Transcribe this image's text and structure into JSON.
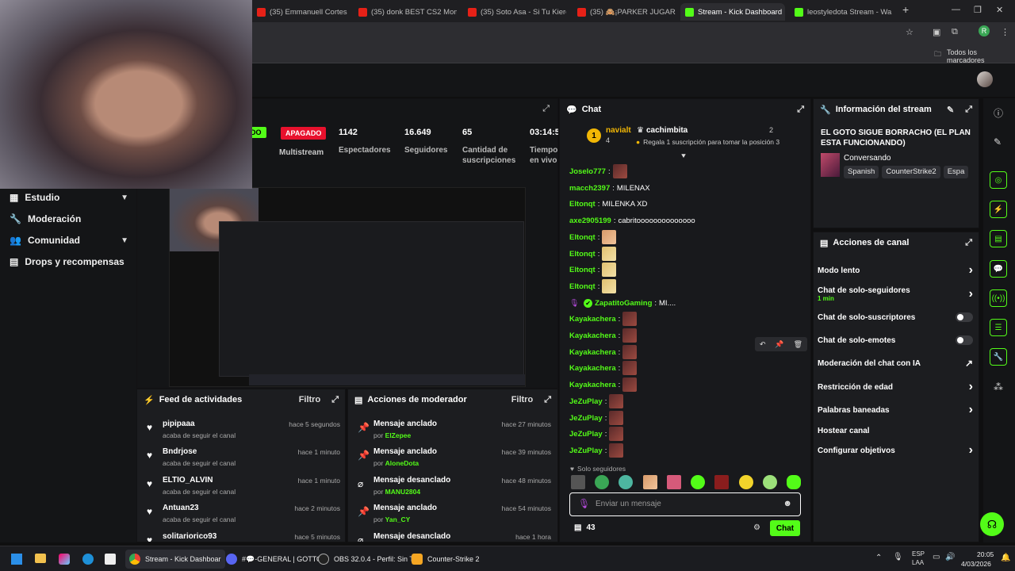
{
  "browser": {
    "tabs": [
      {
        "label": "(35) Emmanuell Cortess -",
        "icon": "youtube-icon"
      },
      {
        "label": "(35) donk BEST CS2 Mom",
        "icon": "youtube-icon"
      },
      {
        "label": "(35) Soto Asa - Si Tu Kiere",
        "icon": "youtube-icon"
      },
      {
        "label": "(35) 🙈¡PARKER JUGARA",
        "icon": "youtube-icon"
      },
      {
        "label": "Stream - Kick Dashboard",
        "icon": "kick-icon"
      },
      {
        "label": "leostyledota Stream - Wa",
        "icon": "kick-icon"
      }
    ],
    "bookmarks_label": "Todos los marcadores",
    "profile_initial": "R"
  },
  "sidebar": {
    "items": [
      {
        "label": "Estudio",
        "icon": "studio-icon",
        "chevron": true
      },
      {
        "label": "Moderación",
        "icon": "wrench-icon",
        "chevron": false
      },
      {
        "label": "Comunidad",
        "icon": "community-icon",
        "chevron": true
      },
      {
        "label": "Drops y recompensas",
        "icon": "gift-icon",
        "chevron": false
      }
    ]
  },
  "stats": {
    "status_partial": "DO",
    "apagado": "APAGADO",
    "multistream": "Multistream",
    "items": [
      {
        "value": "1142",
        "label": "Espectadores"
      },
      {
        "value": "16.649",
        "label": "Seguidores"
      },
      {
        "value": "65",
        "label": "Cantidad de suscripciones"
      },
      {
        "value": "03:14:5",
        "label": "Tiempo en vivo"
      }
    ]
  },
  "feed": {
    "title": "Feed de actividades",
    "filter": "Filtro",
    "rows": [
      {
        "name": "pipipaaa",
        "sub": "acaba de seguir el canal",
        "time": "hace 5 segundos"
      },
      {
        "name": "Bndrjose",
        "sub": "acaba de seguir el canal",
        "time": "hace 1 minuto"
      },
      {
        "name": "ELTIO_ALVIN",
        "sub": "acaba de seguir el canal",
        "time": "hace 1 minuto"
      },
      {
        "name": "Antuan23",
        "sub": "acaba de seguir el canal",
        "time": "hace 2 minutos"
      },
      {
        "name": "solitariorico93",
        "sub": "",
        "time": "hace 5 minutos"
      }
    ]
  },
  "mod": {
    "title": "Acciones de moderador",
    "filter": "Filtro",
    "rows": [
      {
        "action": "Mensaje anclado",
        "by": "por ",
        "user": "ElZepee",
        "time": "hace 27 minutos",
        "icon": "pin-icon"
      },
      {
        "action": "Mensaje anclado",
        "by": "por ",
        "user": "AloneDota",
        "time": "hace 39 minutos",
        "icon": "pin-icon"
      },
      {
        "action": "Mensaje desanclado",
        "by": "por ",
        "user": "MANU2804",
        "time": "hace 48 minutos",
        "icon": "unpin-icon"
      },
      {
        "action": "Mensaje anclado",
        "by": "por ",
        "user": "Yan_CY",
        "time": "hace 54 minutos",
        "icon": "pin-icon"
      },
      {
        "action": "Mensaje desanclado",
        "by": "",
        "user": "",
        "time": "hace 1 hora",
        "icon": "unpin-icon"
      }
    ]
  },
  "chat": {
    "title": "Chat",
    "pinned": {
      "user1": "navialt",
      "count1": "4",
      "user2": "cachimbita",
      "count2": "2",
      "text": "Regala 1 suscripción para tomar la posición 3",
      "rank": "1"
    },
    "messages": [
      {
        "user": "Joselo777",
        "text": "",
        "emotes": [
          "red"
        ],
        "color": "green"
      },
      {
        "user": "macch2397",
        "text": "MILENAX",
        "emotes": [],
        "color": "green"
      },
      {
        "user": "Eltonqt",
        "text": "MILENKA XD",
        "emotes": [],
        "color": "green"
      },
      {
        "user": "axe2905199",
        "text": "cabritoooooooooooooo",
        "emotes": [],
        "color": "green"
      },
      {
        "user": "Eltonqt",
        "text": "",
        "emotes": [
          "tan"
        ],
        "color": "green"
      },
      {
        "user": "Eltonqt",
        "text": "",
        "emotes": [
          "blonde"
        ],
        "color": "green"
      },
      {
        "user": "Eltonqt",
        "text": "",
        "emotes": [
          "blonde"
        ],
        "color": "green"
      },
      {
        "user": "Eltonqt",
        "text": "",
        "emotes": [
          "blonde"
        ],
        "color": "green"
      },
      {
        "user": "ZapatitoGaming",
        "text": "MI....",
        "emotes": [],
        "color": "green",
        "badges": true
      },
      {
        "user": "Kayakachera",
        "text": "",
        "emotes": [
          "red"
        ],
        "color": "green"
      },
      {
        "user": "Kayakachera",
        "text": "",
        "emotes": [
          "red"
        ],
        "color": "green"
      },
      {
        "user": "Kayakachera",
        "text": "",
        "emotes": [
          "red"
        ],
        "color": "green"
      },
      {
        "user": "Kayakachera",
        "text": "",
        "emotes": [
          "red"
        ],
        "color": "green"
      },
      {
        "user": "Kayakachera",
        "text": "",
        "emotes": [
          "red"
        ],
        "color": "green"
      },
      {
        "user": "JeZuPlay",
        "text": "",
        "emotes": [
          "red"
        ],
        "color": "green"
      },
      {
        "user": "JeZuPlay",
        "text": "",
        "emotes": [
          "red"
        ],
        "color": "green"
      },
      {
        "user": "JeZuPlay",
        "text": "",
        "emotes": [
          "red"
        ],
        "color": "green"
      },
      {
        "user": "JeZuPlay",
        "text": "",
        "emotes": [
          "red"
        ],
        "color": "green"
      }
    ],
    "followers_only": "Solo seguidores",
    "input_placeholder": "Enviar un mensaje",
    "viewer_count": "43",
    "send_label": "Chat"
  },
  "stream_info": {
    "title": "Información del stream",
    "stream_title": "EL GOTO SIGUE BORRACHO (EL PLAN ESTA FUNCIONANDO)",
    "category": "Conversando",
    "tags": [
      "Spanish",
      "CounterStrike2",
      "Espa"
    ]
  },
  "channel_actions": {
    "title": "Acciones de canal",
    "items": [
      {
        "label": "Modo lento",
        "sub": "",
        "control": "chevron"
      },
      {
        "label": "Chat de solo-seguidores",
        "sub": "1 min",
        "control": "chevron"
      },
      {
        "label": "Chat de solo-suscriptores",
        "sub": "",
        "control": "toggle"
      },
      {
        "label": "Chat de solo-emotes",
        "sub": "",
        "control": "toggle"
      },
      {
        "label": "Moderación del chat con IA",
        "sub": "",
        "control": "external"
      },
      {
        "label": "Restricción de edad",
        "sub": "",
        "control": "chevron"
      },
      {
        "label": "Palabras baneadas",
        "sub": "",
        "control": "chevron"
      },
      {
        "label": "Hostear canal",
        "sub": "",
        "control": "none"
      },
      {
        "label": "Configurar objetivos",
        "sub": "",
        "control": "chevron"
      }
    ]
  },
  "taskbar": {
    "apps": [
      {
        "label": "Stream - Kick Dashboar",
        "icon": "chrome-icon"
      },
      {
        "label": "#💬-GENERAL | GOTTO",
        "icon": "discord-icon"
      },
      {
        "label": "OBS 32.0.4 - Perfil: Sin T",
        "icon": "obs-icon"
      },
      {
        "label": "Counter-Strike 2",
        "icon": "cs2-icon"
      }
    ],
    "lang": "ESP",
    "lang2": "LAA",
    "time": "20:05",
    "date": "4/03/2026"
  },
  "colors": {
    "kick_green": "#53fc18",
    "apagado_red": "#e8112d",
    "panel": "#1c1d20"
  }
}
